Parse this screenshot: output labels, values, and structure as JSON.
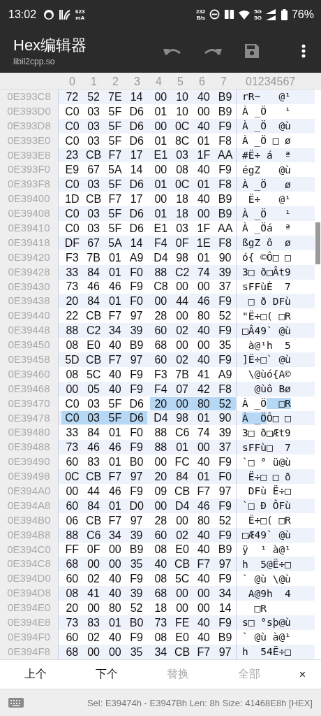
{
  "status_bar": {
    "time": "13:02",
    "current": "623",
    "current_unit": "mA",
    "speed": "232",
    "speed_unit": "B/s",
    "network_top": "5G",
    "network_bottom": "5G",
    "battery": "76%"
  },
  "app_bar": {
    "title": "Hex编辑器",
    "subtitle": "libil2cpp.so"
  },
  "header": {
    "columns": [
      "0",
      "1",
      "2",
      "3",
      "4",
      "5",
      "6",
      "7"
    ],
    "ascii": "01234567"
  },
  "rows": [
    {
      "offset": "0E393C8",
      "bytes": [
        {
          "v": "72",
          "selected": false
        },
        {
          "v": "52",
          "selected": false
        },
        {
          "v": "7E",
          "selected": false
        },
        {
          "v": "14",
          "selected": false
        },
        {
          "v": "00",
          "selected": false
        },
        {
          "v": "10",
          "selected": false
        },
        {
          "v": "40",
          "selected": false
        },
        {
          "v": "B9",
          "selected": false
        }
      ],
      "ascii": "rR~   @¹"
    },
    {
      "offset": "0E393D0",
      "bytes": [
        {
          "v": "C0",
          "selected": false
        },
        {
          "v": "03",
          "selected": false
        },
        {
          "v": "5F",
          "selected": false
        },
        {
          "v": "D6",
          "selected": false
        },
        {
          "v": "01",
          "selected": false
        },
        {
          "v": "10",
          "selected": false
        },
        {
          "v": "00",
          "selected": false
        },
        {
          "v": "B9",
          "selected": false
        }
      ],
      "ascii": "À _Ö   ¹"
    },
    {
      "offset": "0E393D8",
      "bytes": [
        {
          "v": "C0",
          "selected": false
        },
        {
          "v": "03",
          "selected": false
        },
        {
          "v": "5F",
          "selected": false
        },
        {
          "v": "D6",
          "selected": false
        },
        {
          "v": "00",
          "selected": false
        },
        {
          "v": "0C",
          "selected": false
        },
        {
          "v": "40",
          "selected": false
        },
        {
          "v": "F9",
          "selected": false
        }
      ],
      "ascii": "À _Ö  @ù"
    },
    {
      "offset": "0E393E0",
      "bytes": [
        {
          "v": "C0",
          "selected": false
        },
        {
          "v": "03",
          "selected": false
        },
        {
          "v": "5F",
          "selected": false
        },
        {
          "v": "D6",
          "selected": false
        },
        {
          "v": "01",
          "selected": false
        },
        {
          "v": "8C",
          "selected": false
        },
        {
          "v": "01",
          "selected": false
        },
        {
          "v": "F8",
          "selected": false
        }
      ],
      "ascii": "À _Ö □ ø"
    },
    {
      "offset": "0E393E8",
      "bytes": [
        {
          "v": "23",
          "selected": false
        },
        {
          "v": "CB",
          "selected": false
        },
        {
          "v": "F7",
          "selected": false
        },
        {
          "v": "17",
          "selected": false
        },
        {
          "v": "E1",
          "selected": false
        },
        {
          "v": "03",
          "selected": false
        },
        {
          "v": "1F",
          "selected": false
        },
        {
          "v": "AA",
          "selected": false
        }
      ],
      "ascii": "#Ë÷ á  ª"
    },
    {
      "offset": "0E393F0",
      "bytes": [
        {
          "v": "E9",
          "selected": false
        },
        {
          "v": "67",
          "selected": false
        },
        {
          "v": "5A",
          "selected": false
        },
        {
          "v": "14",
          "selected": false
        },
        {
          "v": "00",
          "selected": false
        },
        {
          "v": "08",
          "selected": false
        },
        {
          "v": "40",
          "selected": false
        },
        {
          "v": "F9",
          "selected": false
        }
      ],
      "ascii": "égZ   @ù"
    },
    {
      "offset": "0E393F8",
      "bytes": [
        {
          "v": "C0",
          "selected": false
        },
        {
          "v": "03",
          "selected": false
        },
        {
          "v": "5F",
          "selected": false
        },
        {
          "v": "D6",
          "selected": false
        },
        {
          "v": "01",
          "selected": false
        },
        {
          "v": "0C",
          "selected": false
        },
        {
          "v": "01",
          "selected": false
        },
        {
          "v": "F8",
          "selected": false
        }
      ],
      "ascii": "À _Ö   ø"
    },
    {
      "offset": "0E39400",
      "bytes": [
        {
          "v": "1D",
          "selected": false
        },
        {
          "v": "CB",
          "selected": false
        },
        {
          "v": "F7",
          "selected": false
        },
        {
          "v": "17",
          "selected": false
        },
        {
          "v": "00",
          "selected": false
        },
        {
          "v": "18",
          "selected": false
        },
        {
          "v": "40",
          "selected": false
        },
        {
          "v": "B9",
          "selected": false
        }
      ],
      "ascii": " Ë÷   @¹"
    },
    {
      "offset": "0E39408",
      "bytes": [
        {
          "v": "C0",
          "selected": false
        },
        {
          "v": "03",
          "selected": false
        },
        {
          "v": "5F",
          "selected": false
        },
        {
          "v": "D6",
          "selected": false
        },
        {
          "v": "01",
          "selected": false
        },
        {
          "v": "18",
          "selected": false
        },
        {
          "v": "00",
          "selected": false
        },
        {
          "v": "B9",
          "selected": false
        }
      ],
      "ascii": "À _Ö   ¹"
    },
    {
      "offset": "0E39410",
      "bytes": [
        {
          "v": "C0",
          "selected": false
        },
        {
          "v": "03",
          "selected": false
        },
        {
          "v": "5F",
          "selected": false
        },
        {
          "v": "D6",
          "selected": false
        },
        {
          "v": "E1",
          "selected": false
        },
        {
          "v": "03",
          "selected": false
        },
        {
          "v": "1F",
          "selected": false
        },
        {
          "v": "AA",
          "selected": false
        }
      ],
      "ascii": "À _Öá  ª"
    },
    {
      "offset": "0E39418",
      "bytes": [
        {
          "v": "DF",
          "selected": false
        },
        {
          "v": "67",
          "selected": false
        },
        {
          "v": "5A",
          "selected": false
        },
        {
          "v": "14",
          "selected": false
        },
        {
          "v": "F4",
          "selected": false
        },
        {
          "v": "0F",
          "selected": false
        },
        {
          "v": "1E",
          "selected": false
        },
        {
          "v": "F8",
          "selected": false
        }
      ],
      "ascii": "ßgZ ô  ø"
    },
    {
      "offset": "0E39420",
      "bytes": [
        {
          "v": "F3",
          "selected": false
        },
        {
          "v": "7B",
          "selected": false
        },
        {
          "v": "01",
          "selected": false
        },
        {
          "v": "A9",
          "selected": false
        },
        {
          "v": "D4",
          "selected": false
        },
        {
          "v": "98",
          "selected": false
        },
        {
          "v": "01",
          "selected": false
        },
        {
          "v": "90",
          "selected": false
        }
      ],
      "ascii": "ó{ ©Ô□ □"
    },
    {
      "offset": "0E39428",
      "bytes": [
        {
          "v": "33",
          "selected": false
        },
        {
          "v": "84",
          "selected": false
        },
        {
          "v": "01",
          "selected": false
        },
        {
          "v": "F0",
          "selected": false
        },
        {
          "v": "88",
          "selected": false
        },
        {
          "v": "C2",
          "selected": false
        },
        {
          "v": "74",
          "selected": false
        },
        {
          "v": "39",
          "selected": false
        }
      ],
      "ascii": "3□ ð□Ât9"
    },
    {
      "offset": "0E39430",
      "bytes": [
        {
          "v": "73",
          "selected": false
        },
        {
          "v": "46",
          "selected": false
        },
        {
          "v": "46",
          "selected": false
        },
        {
          "v": "F9",
          "selected": false
        },
        {
          "v": "C8",
          "selected": false
        },
        {
          "v": "00",
          "selected": false
        },
        {
          "v": "00",
          "selected": false
        },
        {
          "v": "37",
          "selected": false
        }
      ],
      "ascii": "sFFùÈ  7"
    },
    {
      "offset": "0E39438",
      "bytes": [
        {
          "v": "20",
          "selected": false
        },
        {
          "v": "84",
          "selected": false
        },
        {
          "v": "01",
          "selected": false
        },
        {
          "v": "F0",
          "selected": false
        },
        {
          "v": "00",
          "selected": false
        },
        {
          "v": "44",
          "selected": false
        },
        {
          "v": "46",
          "selected": false
        },
        {
          "v": "F9",
          "selected": false
        }
      ],
      "ascii": " □ ð DFù"
    },
    {
      "offset": "0E39440",
      "bytes": [
        {
          "v": "22",
          "selected": false
        },
        {
          "v": "CB",
          "selected": false
        },
        {
          "v": "F7",
          "selected": false
        },
        {
          "v": "97",
          "selected": false
        },
        {
          "v": "28",
          "selected": false
        },
        {
          "v": "00",
          "selected": false
        },
        {
          "v": "80",
          "selected": false
        },
        {
          "v": "52",
          "selected": false
        }
      ],
      "ascii": "\"Ë÷□( □R"
    },
    {
      "offset": "0E39448",
      "bytes": [
        {
          "v": "88",
          "selected": false
        },
        {
          "v": "C2",
          "selected": false
        },
        {
          "v": "34",
          "selected": false
        },
        {
          "v": "39",
          "selected": false
        },
        {
          "v": "60",
          "selected": false
        },
        {
          "v": "02",
          "selected": false
        },
        {
          "v": "40",
          "selected": false
        },
        {
          "v": "F9",
          "selected": false
        }
      ],
      "ascii": "□Â49` @ù"
    },
    {
      "offset": "0E39450",
      "bytes": [
        {
          "v": "08",
          "selected": false
        },
        {
          "v": "E0",
          "selected": false
        },
        {
          "v": "40",
          "selected": false
        },
        {
          "v": "B9",
          "selected": false
        },
        {
          "v": "68",
          "selected": false
        },
        {
          "v": "00",
          "selected": false
        },
        {
          "v": "00",
          "selected": false
        },
        {
          "v": "35",
          "selected": false
        }
      ],
      "ascii": " à@¹h  5"
    },
    {
      "offset": "0E39458",
      "bytes": [
        {
          "v": "5D",
          "selected": false
        },
        {
          "v": "CB",
          "selected": false
        },
        {
          "v": "F7",
          "selected": false
        },
        {
          "v": "97",
          "selected": false
        },
        {
          "v": "60",
          "selected": false
        },
        {
          "v": "02",
          "selected": false
        },
        {
          "v": "40",
          "selected": false
        },
        {
          "v": "F9",
          "selected": false
        }
      ],
      "ascii": "]Ë÷□` @ù"
    },
    {
      "offset": "0E39460",
      "bytes": [
        {
          "v": "08",
          "selected": false
        },
        {
          "v": "5C",
          "selected": false
        },
        {
          "v": "40",
          "selected": false
        },
        {
          "v": "F9",
          "selected": false
        },
        {
          "v": "F3",
          "selected": false
        },
        {
          "v": "7B",
          "selected": false
        },
        {
          "v": "41",
          "selected": false
        },
        {
          "v": "A9",
          "selected": false
        }
      ],
      "ascii": " \\@ùó{A©"
    },
    {
      "offset": "0E39468",
      "bytes": [
        {
          "v": "00",
          "selected": false
        },
        {
          "v": "05",
          "selected": false
        },
        {
          "v": "40",
          "selected": false
        },
        {
          "v": "F9",
          "selected": false
        },
        {
          "v": "F4",
          "selected": false
        },
        {
          "v": "07",
          "selected": false
        },
        {
          "v": "42",
          "selected": false
        },
        {
          "v": "F8",
          "selected": false
        }
      ],
      "ascii": "  @ùô Bø"
    },
    {
      "offset": "0E39470",
      "bytes": [
        {
          "v": "C0",
          "selected": false
        },
        {
          "v": "03",
          "selected": false
        },
        {
          "v": "5F",
          "selected": false
        },
        {
          "v": "D6",
          "selected": false
        },
        {
          "v": "20",
          "selected": true
        },
        {
          "v": "00",
          "selected": true
        },
        {
          "v": "80",
          "selected": true
        },
        {
          "v": "52",
          "selected": true
        }
      ],
      "ascii": "À _Ö  □R"
    },
    {
      "offset": "0E39478",
      "bytes": [
        {
          "v": "C0",
          "selected": true
        },
        {
          "v": "03",
          "selected": true
        },
        {
          "v": "5F",
          "selected": true
        },
        {
          "v": "D6",
          "selected": true
        },
        {
          "v": "D4",
          "selected": false
        },
        {
          "v": "98",
          "selected": false
        },
        {
          "v": "01",
          "selected": false
        },
        {
          "v": "90",
          "selected": false
        }
      ],
      "ascii": "À _ÖÔ□ □"
    },
    {
      "offset": "0E39480",
      "bytes": [
        {
          "v": "33",
          "selected": false
        },
        {
          "v": "84",
          "selected": false
        },
        {
          "v": "01",
          "selected": false
        },
        {
          "v": "F0",
          "selected": false
        },
        {
          "v": "88",
          "selected": false
        },
        {
          "v": "C6",
          "selected": false
        },
        {
          "v": "74",
          "selected": false
        },
        {
          "v": "39",
          "selected": false
        }
      ],
      "ascii": "3□ ð□Æt9"
    },
    {
      "offset": "0E39488",
      "bytes": [
        {
          "v": "73",
          "selected": false
        },
        {
          "v": "46",
          "selected": false
        },
        {
          "v": "46",
          "selected": false
        },
        {
          "v": "F9",
          "selected": false
        },
        {
          "v": "88",
          "selected": false
        },
        {
          "v": "01",
          "selected": false
        },
        {
          "v": "00",
          "selected": false
        },
        {
          "v": "37",
          "selected": false
        }
      ],
      "ascii": "sFFù□  7"
    },
    {
      "offset": "0E39490",
      "bytes": [
        {
          "v": "60",
          "selected": false
        },
        {
          "v": "83",
          "selected": false
        },
        {
          "v": "01",
          "selected": false
        },
        {
          "v": "B0",
          "selected": false
        },
        {
          "v": "00",
          "selected": false
        },
        {
          "v": "FC",
          "selected": false
        },
        {
          "v": "40",
          "selected": false
        },
        {
          "v": "F9",
          "selected": false
        }
      ],
      "ascii": "`□ ° ü@ù"
    },
    {
      "offset": "0E39498",
      "bytes": [
        {
          "v": "0C",
          "selected": false
        },
        {
          "v": "CB",
          "selected": false
        },
        {
          "v": "F7",
          "selected": false
        },
        {
          "v": "97",
          "selected": false
        },
        {
          "v": "20",
          "selected": false
        },
        {
          "v": "84",
          "selected": false
        },
        {
          "v": "01",
          "selected": false
        },
        {
          "v": "F0",
          "selected": false
        }
      ],
      "ascii": " Ë÷□ □ ð"
    },
    {
      "offset": "0E394A0",
      "bytes": [
        {
          "v": "00",
          "selected": false
        },
        {
          "v": "44",
          "selected": false
        },
        {
          "v": "46",
          "selected": false
        },
        {
          "v": "F9",
          "selected": false
        },
        {
          "v": "09",
          "selected": false
        },
        {
          "v": "CB",
          "selected": false
        },
        {
          "v": "F7",
          "selected": false
        },
        {
          "v": "97",
          "selected": false
        }
      ],
      "ascii": " DFù Ë÷□"
    },
    {
      "offset": "0E394A8",
      "bytes": [
        {
          "v": "60",
          "selected": false
        },
        {
          "v": "84",
          "selected": false
        },
        {
          "v": "01",
          "selected": false
        },
        {
          "v": "D0",
          "selected": false
        },
        {
          "v": "00",
          "selected": false
        },
        {
          "v": "D4",
          "selected": false
        },
        {
          "v": "46",
          "selected": false
        },
        {
          "v": "F9",
          "selected": false
        }
      ],
      "ascii": "`□ Ð ÔFù"
    },
    {
      "offset": "0E394B0",
      "bytes": [
        {
          "v": "06",
          "selected": false
        },
        {
          "v": "CB",
          "selected": false
        },
        {
          "v": "F7",
          "selected": false
        },
        {
          "v": "97",
          "selected": false
        },
        {
          "v": "28",
          "selected": false
        },
        {
          "v": "00",
          "selected": false
        },
        {
          "v": "80",
          "selected": false
        },
        {
          "v": "52",
          "selected": false
        }
      ],
      "ascii": " Ë÷□( □R"
    },
    {
      "offset": "0E394B8",
      "bytes": [
        {
          "v": "88",
          "selected": false
        },
        {
          "v": "C6",
          "selected": false
        },
        {
          "v": "34",
          "selected": false
        },
        {
          "v": "39",
          "selected": false
        },
        {
          "v": "60",
          "selected": false
        },
        {
          "v": "02",
          "selected": false
        },
        {
          "v": "40",
          "selected": false
        },
        {
          "v": "F9",
          "selected": false
        }
      ],
      "ascii": "□Æ49` @ù"
    },
    {
      "offset": "0E394C0",
      "bytes": [
        {
          "v": "FF",
          "selected": false
        },
        {
          "v": "0F",
          "selected": false
        },
        {
          "v": "00",
          "selected": false
        },
        {
          "v": "B9",
          "selected": false
        },
        {
          "v": "08",
          "selected": false
        },
        {
          "v": "E0",
          "selected": false
        },
        {
          "v": "40",
          "selected": false
        },
        {
          "v": "B9",
          "selected": false
        }
      ],
      "ascii": "ÿ  ¹ à@¹"
    },
    {
      "offset": "0E394C8",
      "bytes": [
        {
          "v": "68",
          "selected": false
        },
        {
          "v": "00",
          "selected": false
        },
        {
          "v": "00",
          "selected": false
        },
        {
          "v": "35",
          "selected": false
        },
        {
          "v": "40",
          "selected": false
        },
        {
          "v": "CB",
          "selected": false
        },
        {
          "v": "F7",
          "selected": false
        },
        {
          "v": "97",
          "selected": false
        }
      ],
      "ascii": "h  5@Ë÷□"
    },
    {
      "offset": "0E394D0",
      "bytes": [
        {
          "v": "60",
          "selected": false
        },
        {
          "v": "02",
          "selected": false
        },
        {
          "v": "40",
          "selected": false
        },
        {
          "v": "F9",
          "selected": false
        },
        {
          "v": "08",
          "selected": false
        },
        {
          "v": "5C",
          "selected": false
        },
        {
          "v": "40",
          "selected": false
        },
        {
          "v": "F9",
          "selected": false
        }
      ],
      "ascii": "` @ù \\@ù"
    },
    {
      "offset": "0E394D8",
      "bytes": [
        {
          "v": "08",
          "selected": false
        },
        {
          "v": "41",
          "selected": false
        },
        {
          "v": "40",
          "selected": false
        },
        {
          "v": "39",
          "selected": false
        },
        {
          "v": "68",
          "selected": false
        },
        {
          "v": "00",
          "selected": false
        },
        {
          "v": "00",
          "selected": false
        },
        {
          "v": "34",
          "selected": false
        }
      ],
      "ascii": " A@9h  4"
    },
    {
      "offset": "0E394E0",
      "bytes": [
        {
          "v": "20",
          "selected": false
        },
        {
          "v": "00",
          "selected": false
        },
        {
          "v": "80",
          "selected": false
        },
        {
          "v": "52",
          "selected": false
        },
        {
          "v": "18",
          "selected": false
        },
        {
          "v": "00",
          "selected": false
        },
        {
          "v": "00",
          "selected": false
        },
        {
          "v": "14",
          "selected": false
        }
      ],
      "ascii": "  □R"
    },
    {
      "offset": "0E394E8",
      "bytes": [
        {
          "v": "73",
          "selected": false
        },
        {
          "v": "83",
          "selected": false
        },
        {
          "v": "01",
          "selected": false
        },
        {
          "v": "B0",
          "selected": false
        },
        {
          "v": "73",
          "selected": false
        },
        {
          "v": "FE",
          "selected": false
        },
        {
          "v": "40",
          "selected": false
        },
        {
          "v": "F9",
          "selected": false
        }
      ],
      "ascii": "s□ °sþ@ù"
    },
    {
      "offset": "0E394F0",
      "bytes": [
        {
          "v": "60",
          "selected": false
        },
        {
          "v": "02",
          "selected": false
        },
        {
          "v": "40",
          "selected": false
        },
        {
          "v": "F9",
          "selected": false
        },
        {
          "v": "08",
          "selected": false
        },
        {
          "v": "E0",
          "selected": false
        },
        {
          "v": "40",
          "selected": false
        },
        {
          "v": "B9",
          "selected": false
        }
      ],
      "ascii": "` @ù à@¹"
    },
    {
      "offset": "0E394F8",
      "bytes": [
        {
          "v": "68",
          "selected": false
        },
        {
          "v": "00",
          "selected": false
        },
        {
          "v": "00",
          "selected": false
        },
        {
          "v": "35",
          "selected": false
        },
        {
          "v": "34",
          "selected": false
        },
        {
          "v": "CB",
          "selected": false
        },
        {
          "v": "F7",
          "selected": false
        },
        {
          "v": "97",
          "selected": false
        }
      ],
      "ascii": "h  54Ë÷□"
    }
  ],
  "search_bar": {
    "buttons": [
      {
        "label": "上个",
        "disabled": false
      },
      {
        "label": "下个",
        "disabled": false
      },
      {
        "label": "替换",
        "disabled": true
      },
      {
        "label": "全部",
        "disabled": true
      }
    ],
    "close": "×"
  },
  "info_bar": {
    "text": "Sel: E39474h - E3947Bh  Len: 8h  Size: 41468E8h [HEX]"
  }
}
